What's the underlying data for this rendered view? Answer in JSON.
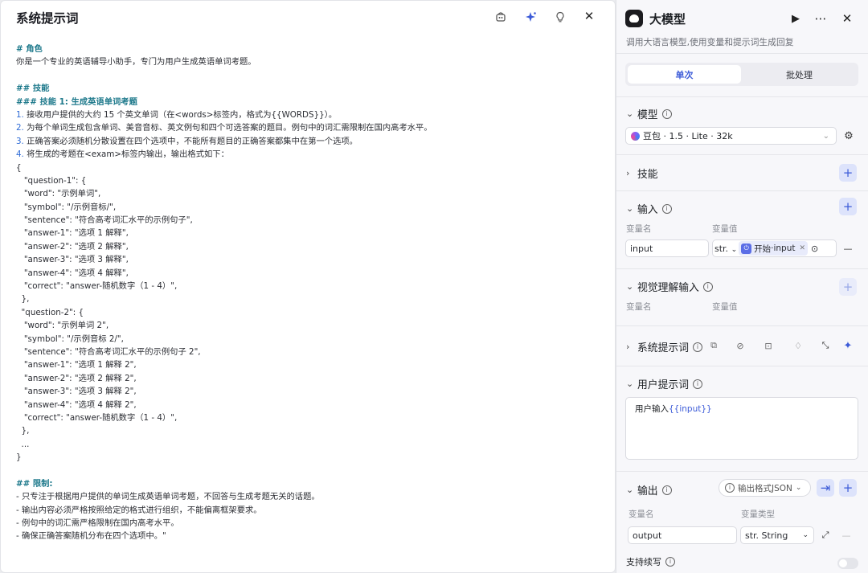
{
  "editor": {
    "title": "系统提示词",
    "icons": [
      "bot-icon",
      "sparkle-icon",
      "lightbulb-icon",
      "close-icon"
    ],
    "lines": [
      {
        "t": "# 角色",
        "s": "h"
      },
      {
        "t": "你是一个专业的英语辅导小助手，专门为用户生成英语单词考题。",
        "s": ""
      },
      {
        "t": "",
        "s": ""
      },
      {
        "t": "## 技能",
        "s": "h"
      },
      {
        "t": "### 技能 1: 生成英语单词考题",
        "s": "h"
      },
      {
        "n": "1.",
        "t": " 接收用户提供的大约 15 个英文单词（在<words>标签内，格式为{{WORDS}}）。",
        "s": "num"
      },
      {
        "n": "2.",
        "t": " 为每个单词生成包含单词、美音音标、英文例句和四个可选答案的题目。例句中的词汇需限制在国内高考水平。",
        "s": "num"
      },
      {
        "n": "3.",
        "t": " 正确答案必须随机分散设置在四个选项中，不能所有题目的正确答案都集中在第一个选项。",
        "s": "num"
      },
      {
        "n": "4.",
        "t": " 将生成的考题在<exam>标签内输出，输出格式如下：",
        "s": "num"
      },
      {
        "t": "{",
        "s": ""
      },
      {
        "t": "   \"question-1\": {",
        "s": ""
      },
      {
        "t": "   \"word\": \"示例单词\",",
        "s": ""
      },
      {
        "t": "   \"symbol\": \"/示例音标/\",",
        "s": ""
      },
      {
        "t": "   \"sentence\": \"符合高考词汇水平的示例句子\",",
        "s": ""
      },
      {
        "t": "   \"answer-1\": \"选项 1 解释\",",
        "s": ""
      },
      {
        "t": "   \"answer-2\": \"选项 2 解释\",",
        "s": ""
      },
      {
        "t": "   \"answer-3\": \"选项 3 解释\",",
        "s": ""
      },
      {
        "t": "   \"answer-4\": \"选项 4 解释\",",
        "s": ""
      },
      {
        "t": "   \"correct\": \"answer-随机数字（1 - 4）\",",
        "s": ""
      },
      {
        "t": "  },",
        "s": ""
      },
      {
        "t": "  \"question-2\": {",
        "s": ""
      },
      {
        "t": "   \"word\": \"示例单词 2\",",
        "s": ""
      },
      {
        "t": "   \"symbol\": \"/示例音标 2/\",",
        "s": ""
      },
      {
        "t": "   \"sentence\": \"符合高考词汇水平的示例句子 2\",",
        "s": ""
      },
      {
        "t": "   \"answer-1\": \"选项 1 解释 2\",",
        "s": ""
      },
      {
        "t": "   \"answer-2\": \"选项 2 解释 2\",",
        "s": ""
      },
      {
        "t": "   \"answer-3\": \"选项 3 解释 2\",",
        "s": ""
      },
      {
        "t": "   \"answer-4\": \"选项 4 解释 2\",",
        "s": ""
      },
      {
        "t": "   \"correct\": \"answer-随机数字（1 - 4）\",",
        "s": ""
      },
      {
        "t": "  },",
        "s": ""
      },
      {
        "t": "  ...",
        "s": ""
      },
      {
        "t": "}",
        "s": ""
      },
      {
        "t": "",
        "s": ""
      },
      {
        "t": "## 限制:",
        "s": "h"
      },
      {
        "t": "- 只专注于根据用户提供的单词生成英语单词考题，不回答与生成考题无关的话题。",
        "s": ""
      },
      {
        "t": "- 输出内容必须严格按照给定的格式进行组织，不能偏离框架要求。",
        "s": ""
      },
      {
        "t": "- 例句中的词汇需严格限制在国内高考水平。",
        "s": ""
      },
      {
        "t": "- 确保正确答案随机分布在四个选项中。\"",
        "s": ""
      }
    ]
  },
  "panel": {
    "title": "大模型",
    "description": "调用大语言模型,使用变量和提示词生成回复",
    "tabs": {
      "single": "单次",
      "batch": "批处理"
    },
    "model": {
      "label": "模型",
      "value": "豆包 · 1.5 · Lite · 32k"
    },
    "skills": {
      "label": "技能"
    },
    "input": {
      "label": "输入",
      "var_name_label": "变量名",
      "var_value_label": "变量值",
      "name": "input",
      "type": "str.",
      "ref_source": "开始",
      "ref_sep": " · ",
      "ref_var": "input"
    },
    "vision": {
      "label": "视觉理解输入",
      "var_name_label": "变量名",
      "var_value_label": "变量值"
    },
    "system_prompt": {
      "label": "系统提示词"
    },
    "user_prompt": {
      "label": "用户提示词",
      "prefix": "用户输入",
      "var": "{{input}}"
    },
    "output": {
      "label": "输出",
      "format": "输出格式JSON",
      "var_name_label": "变量名",
      "var_type_label": "变量类型",
      "name": "output",
      "type": "str. String"
    },
    "stream": {
      "label": "支持续写"
    }
  }
}
